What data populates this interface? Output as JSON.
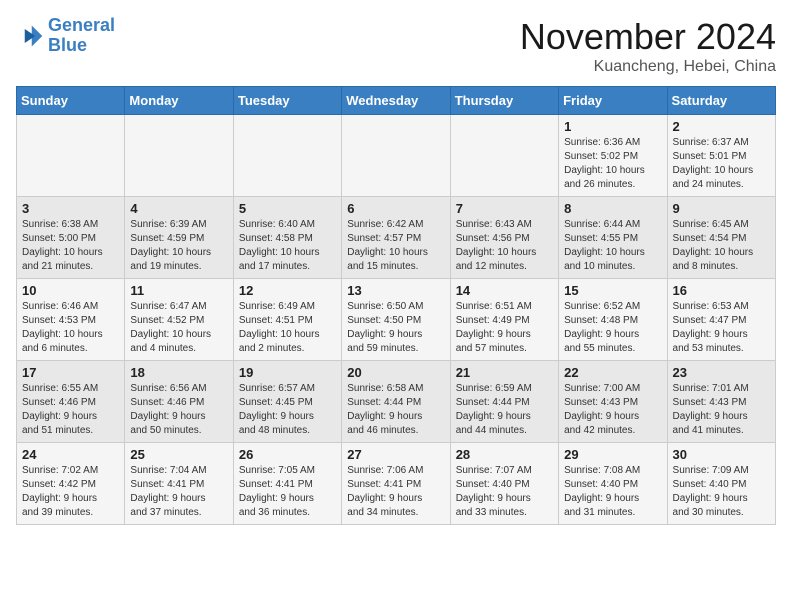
{
  "header": {
    "logo_line1": "General",
    "logo_line2": "Blue",
    "title": "November 2024",
    "subtitle": "Kuancheng, Hebei, China"
  },
  "weekdays": [
    "Sunday",
    "Monday",
    "Tuesday",
    "Wednesday",
    "Thursday",
    "Friday",
    "Saturday"
  ],
  "weeks": [
    [
      {
        "day": "",
        "info": ""
      },
      {
        "day": "",
        "info": ""
      },
      {
        "day": "",
        "info": ""
      },
      {
        "day": "",
        "info": ""
      },
      {
        "day": "",
        "info": ""
      },
      {
        "day": "1",
        "info": "Sunrise: 6:36 AM\nSunset: 5:02 PM\nDaylight: 10 hours\nand 26 minutes."
      },
      {
        "day": "2",
        "info": "Sunrise: 6:37 AM\nSunset: 5:01 PM\nDaylight: 10 hours\nand 24 minutes."
      }
    ],
    [
      {
        "day": "3",
        "info": "Sunrise: 6:38 AM\nSunset: 5:00 PM\nDaylight: 10 hours\nand 21 minutes."
      },
      {
        "day": "4",
        "info": "Sunrise: 6:39 AM\nSunset: 4:59 PM\nDaylight: 10 hours\nand 19 minutes."
      },
      {
        "day": "5",
        "info": "Sunrise: 6:40 AM\nSunset: 4:58 PM\nDaylight: 10 hours\nand 17 minutes."
      },
      {
        "day": "6",
        "info": "Sunrise: 6:42 AM\nSunset: 4:57 PM\nDaylight: 10 hours\nand 15 minutes."
      },
      {
        "day": "7",
        "info": "Sunrise: 6:43 AM\nSunset: 4:56 PM\nDaylight: 10 hours\nand 12 minutes."
      },
      {
        "day": "8",
        "info": "Sunrise: 6:44 AM\nSunset: 4:55 PM\nDaylight: 10 hours\nand 10 minutes."
      },
      {
        "day": "9",
        "info": "Sunrise: 6:45 AM\nSunset: 4:54 PM\nDaylight: 10 hours\nand 8 minutes."
      }
    ],
    [
      {
        "day": "10",
        "info": "Sunrise: 6:46 AM\nSunset: 4:53 PM\nDaylight: 10 hours\nand 6 minutes."
      },
      {
        "day": "11",
        "info": "Sunrise: 6:47 AM\nSunset: 4:52 PM\nDaylight: 10 hours\nand 4 minutes."
      },
      {
        "day": "12",
        "info": "Sunrise: 6:49 AM\nSunset: 4:51 PM\nDaylight: 10 hours\nand 2 minutes."
      },
      {
        "day": "13",
        "info": "Sunrise: 6:50 AM\nSunset: 4:50 PM\nDaylight: 9 hours\nand 59 minutes."
      },
      {
        "day": "14",
        "info": "Sunrise: 6:51 AM\nSunset: 4:49 PM\nDaylight: 9 hours\nand 57 minutes."
      },
      {
        "day": "15",
        "info": "Sunrise: 6:52 AM\nSunset: 4:48 PM\nDaylight: 9 hours\nand 55 minutes."
      },
      {
        "day": "16",
        "info": "Sunrise: 6:53 AM\nSunset: 4:47 PM\nDaylight: 9 hours\nand 53 minutes."
      }
    ],
    [
      {
        "day": "17",
        "info": "Sunrise: 6:55 AM\nSunset: 4:46 PM\nDaylight: 9 hours\nand 51 minutes."
      },
      {
        "day": "18",
        "info": "Sunrise: 6:56 AM\nSunset: 4:46 PM\nDaylight: 9 hours\nand 50 minutes."
      },
      {
        "day": "19",
        "info": "Sunrise: 6:57 AM\nSunset: 4:45 PM\nDaylight: 9 hours\nand 48 minutes."
      },
      {
        "day": "20",
        "info": "Sunrise: 6:58 AM\nSunset: 4:44 PM\nDaylight: 9 hours\nand 46 minutes."
      },
      {
        "day": "21",
        "info": "Sunrise: 6:59 AM\nSunset: 4:44 PM\nDaylight: 9 hours\nand 44 minutes."
      },
      {
        "day": "22",
        "info": "Sunrise: 7:00 AM\nSunset: 4:43 PM\nDaylight: 9 hours\nand 42 minutes."
      },
      {
        "day": "23",
        "info": "Sunrise: 7:01 AM\nSunset: 4:43 PM\nDaylight: 9 hours\nand 41 minutes."
      }
    ],
    [
      {
        "day": "24",
        "info": "Sunrise: 7:02 AM\nSunset: 4:42 PM\nDaylight: 9 hours\nand 39 minutes."
      },
      {
        "day": "25",
        "info": "Sunrise: 7:04 AM\nSunset: 4:41 PM\nDaylight: 9 hours\nand 37 minutes."
      },
      {
        "day": "26",
        "info": "Sunrise: 7:05 AM\nSunset: 4:41 PM\nDaylight: 9 hours\nand 36 minutes."
      },
      {
        "day": "27",
        "info": "Sunrise: 7:06 AM\nSunset: 4:41 PM\nDaylight: 9 hours\nand 34 minutes."
      },
      {
        "day": "28",
        "info": "Sunrise: 7:07 AM\nSunset: 4:40 PM\nDaylight: 9 hours\nand 33 minutes."
      },
      {
        "day": "29",
        "info": "Sunrise: 7:08 AM\nSunset: 4:40 PM\nDaylight: 9 hours\nand 31 minutes."
      },
      {
        "day": "30",
        "info": "Sunrise: 7:09 AM\nSunset: 4:40 PM\nDaylight: 9 hours\nand 30 minutes."
      }
    ]
  ]
}
